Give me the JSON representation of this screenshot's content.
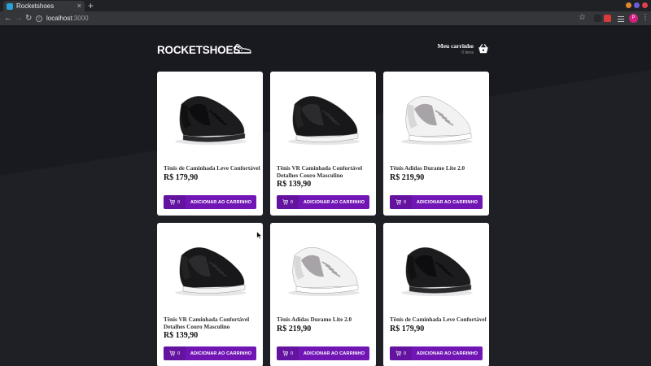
{
  "browser": {
    "tab_title": "Rocketshoes",
    "tab_close": "×",
    "new_tab": "+",
    "url_host": "localhost",
    "url_port": ":3000",
    "profile_initial": "P"
  },
  "header": {
    "logo": "ROCKETSHOES",
    "cart_title": "Meu carrinho",
    "cart_count": "0 itens"
  },
  "products": [
    {
      "title": "Tênis de Caminhada Leve Confortável",
      "price": "R$ 179,90",
      "amount": "0",
      "button": "ADICIONAR AO CARRINHO",
      "color": "black"
    },
    {
      "title": "Tênis VR Caminhada Confortável Detalhes Couro Masculino",
      "price": "R$ 139,90",
      "amount": "0",
      "button": "ADICIONAR AO CARRINHO",
      "color": "black-white"
    },
    {
      "title": "Tênis Adidas Duramo Lite 2.0",
      "price": "R$ 219,90",
      "amount": "0",
      "button": "ADICIONAR AO CARRINHO",
      "color": "white-gray"
    },
    {
      "title": "Tênis VR Caminhada Confortável Detalhes Couro Masculino",
      "price": "R$ 139,90",
      "amount": "0",
      "button": "ADICIONAR AO CARRINHO",
      "color": "black-white"
    },
    {
      "title": "Tênis Adidas Duramo Lite 2.0",
      "price": "R$ 219,90",
      "amount": "0",
      "button": "ADICIONAR AO CARRINHO",
      "color": "white-gray"
    },
    {
      "title": "Tênis de Caminhada Leve Confortável",
      "price": "R$ 179,90",
      "amount": "0",
      "button": "ADICIONAR AO CARRINHO",
      "color": "black"
    }
  ],
  "colors": {
    "page_background": "#191920",
    "accent": "#7116b5",
    "card": "#ffffff"
  }
}
